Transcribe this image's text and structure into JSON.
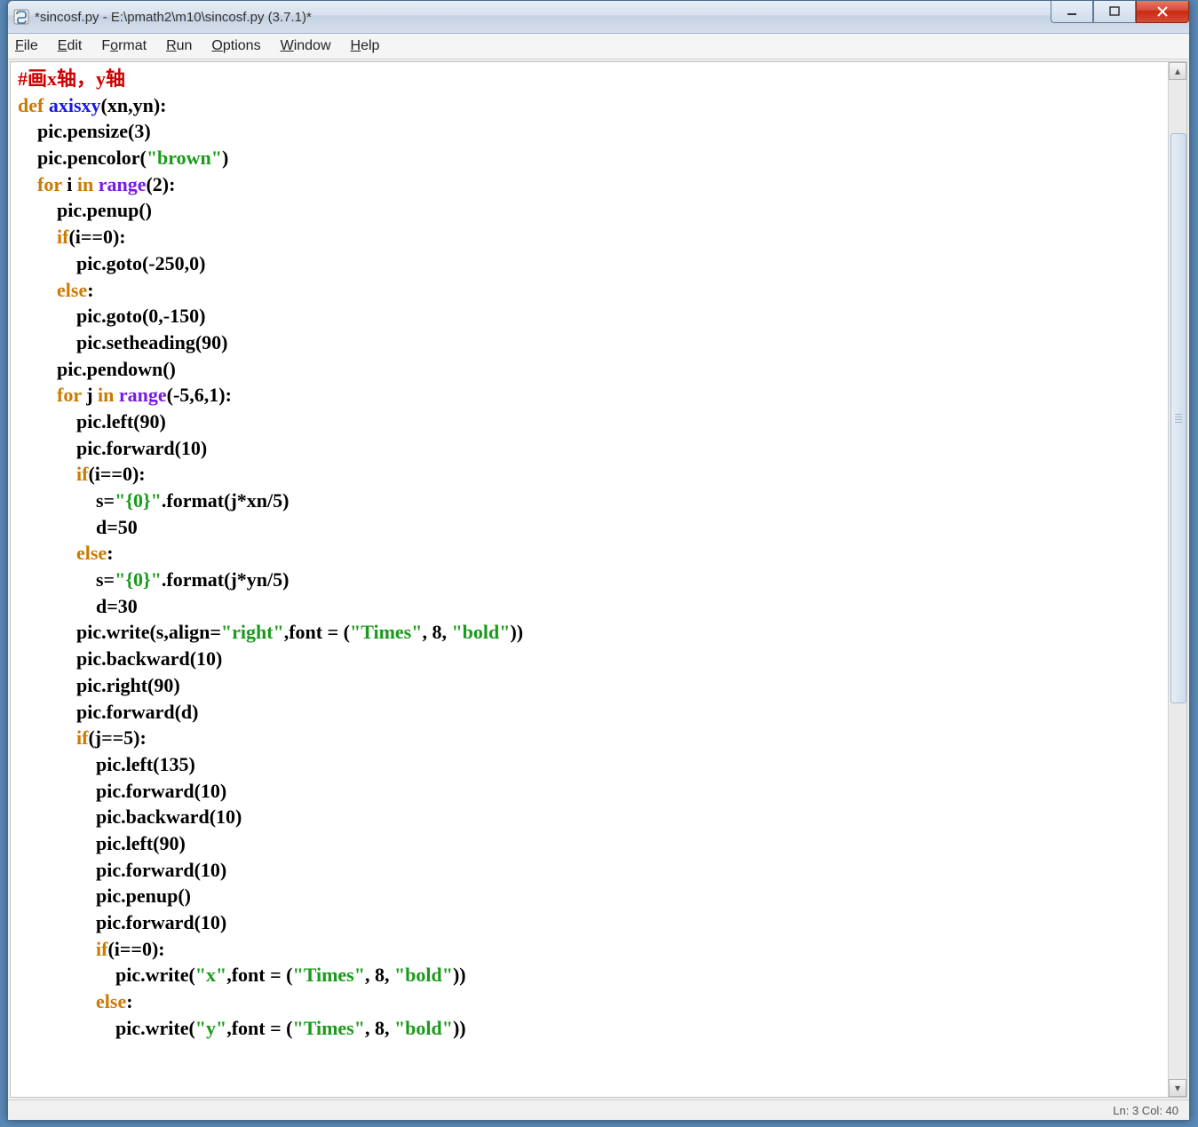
{
  "window": {
    "title": "*sincosf.py - E:\\pmath2\\m10\\sincosf.py (3.7.1)*"
  },
  "menus": [
    "File",
    "Edit",
    "Format",
    "Run",
    "Options",
    "Window",
    "Help"
  ],
  "statusbar": "Ln: 3  Col: 40",
  "code": {
    "tokens": [
      [
        [
          "c-comment",
          "#画x轴，y轴"
        ]
      ],
      [
        [
          "c-keyword",
          "def "
        ],
        [
          "c-def",
          "axisxy"
        ],
        [
          "c-text",
          "(xn,yn):"
        ]
      ],
      [
        [
          "c-text",
          "    pic.pensize(3)"
        ]
      ],
      [
        [
          "c-text",
          "    pic.pencolor("
        ],
        [
          "c-string",
          "\"brown\""
        ],
        [
          "c-text",
          ")"
        ]
      ],
      [
        [
          "c-text",
          "    "
        ],
        [
          "c-keyword",
          "for"
        ],
        [
          "c-text",
          " i "
        ],
        [
          "c-keyword",
          "in"
        ],
        [
          "c-text",
          " "
        ],
        [
          "c-builtin",
          "range"
        ],
        [
          "c-text",
          "(2):"
        ]
      ],
      [
        [
          "c-text",
          "        pic.penup()"
        ]
      ],
      [
        [
          "c-text",
          "        "
        ],
        [
          "c-keyword",
          "if"
        ],
        [
          "c-text",
          "(i==0):"
        ]
      ],
      [
        [
          "c-text",
          "            pic.goto(-250,0)"
        ]
      ],
      [
        [
          "c-text",
          "        "
        ],
        [
          "c-keyword",
          "else"
        ],
        [
          "c-text",
          ":"
        ]
      ],
      [
        [
          "c-text",
          "            pic.goto(0,-150)"
        ]
      ],
      [
        [
          "c-text",
          "            pic.setheading(90)"
        ]
      ],
      [
        [
          "c-text",
          "        pic.pendown()"
        ]
      ],
      [
        [
          "c-text",
          "        "
        ],
        [
          "c-keyword",
          "for"
        ],
        [
          "c-text",
          " j "
        ],
        [
          "c-keyword",
          "in"
        ],
        [
          "c-text",
          " "
        ],
        [
          "c-builtin",
          "range"
        ],
        [
          "c-text",
          "(-5,6,1):"
        ]
      ],
      [
        [
          "c-text",
          "            pic.left(90)"
        ]
      ],
      [
        [
          "c-text",
          "            pic.forward(10)"
        ]
      ],
      [
        [
          "c-text",
          "            "
        ],
        [
          "c-keyword",
          "if"
        ],
        [
          "c-text",
          "(i==0):"
        ]
      ],
      [
        [
          "c-text",
          "                s="
        ],
        [
          "c-string",
          "\"{0}\""
        ],
        [
          "c-text",
          ".format(j*xn/5)"
        ]
      ],
      [
        [
          "c-text",
          "                d=50"
        ]
      ],
      [
        [
          "c-text",
          "            "
        ],
        [
          "c-keyword",
          "else"
        ],
        [
          "c-text",
          ":"
        ]
      ],
      [
        [
          "c-text",
          "                s="
        ],
        [
          "c-string",
          "\"{0}\""
        ],
        [
          "c-text",
          ".format(j*yn/5)"
        ]
      ],
      [
        [
          "c-text",
          "                d=30"
        ]
      ],
      [
        [
          "c-text",
          "            pic.write(s,align="
        ],
        [
          "c-string",
          "\"right\""
        ],
        [
          "c-text",
          ",font = ("
        ],
        [
          "c-string",
          "\"Times\""
        ],
        [
          "c-text",
          ", 8, "
        ],
        [
          "c-string",
          "\"bold\""
        ],
        [
          "c-text",
          "))"
        ]
      ],
      [
        [
          "c-text",
          "            pic.backward(10)"
        ]
      ],
      [
        [
          "c-text",
          "            pic.right(90)"
        ]
      ],
      [
        [
          "c-text",
          "            pic.forward(d)"
        ]
      ],
      [
        [
          "c-text",
          "            "
        ],
        [
          "c-keyword",
          "if"
        ],
        [
          "c-text",
          "(j==5):"
        ]
      ],
      [
        [
          "c-text",
          "                pic.left(135)"
        ]
      ],
      [
        [
          "c-text",
          "                pic.forward(10)"
        ]
      ],
      [
        [
          "c-text",
          "                pic.backward(10)"
        ]
      ],
      [
        [
          "c-text",
          "                pic.left(90)"
        ]
      ],
      [
        [
          "c-text",
          "                pic.forward(10)"
        ]
      ],
      [
        [
          "c-text",
          "                pic.penup()"
        ]
      ],
      [
        [
          "c-text",
          "                pic.forward(10)"
        ]
      ],
      [
        [
          "c-text",
          "                "
        ],
        [
          "c-keyword",
          "if"
        ],
        [
          "c-text",
          "(i==0):"
        ]
      ],
      [
        [
          "c-text",
          "                    pic.write("
        ],
        [
          "c-string",
          "\"x\""
        ],
        [
          "c-text",
          ",font = ("
        ],
        [
          "c-string",
          "\"Times\""
        ],
        [
          "c-text",
          ", 8, "
        ],
        [
          "c-string",
          "\"bold\""
        ],
        [
          "c-text",
          "))"
        ]
      ],
      [
        [
          "c-text",
          "                "
        ],
        [
          "c-keyword",
          "else"
        ],
        [
          "c-text",
          ":"
        ]
      ],
      [
        [
          "c-text",
          "                    pic.write("
        ],
        [
          "c-string",
          "\"y\""
        ],
        [
          "c-text",
          ",font = ("
        ],
        [
          "c-string",
          "\"Times\""
        ],
        [
          "c-text",
          ", 8, "
        ],
        [
          "c-string",
          "\"bold\""
        ],
        [
          "c-text",
          "))"
        ]
      ]
    ]
  }
}
